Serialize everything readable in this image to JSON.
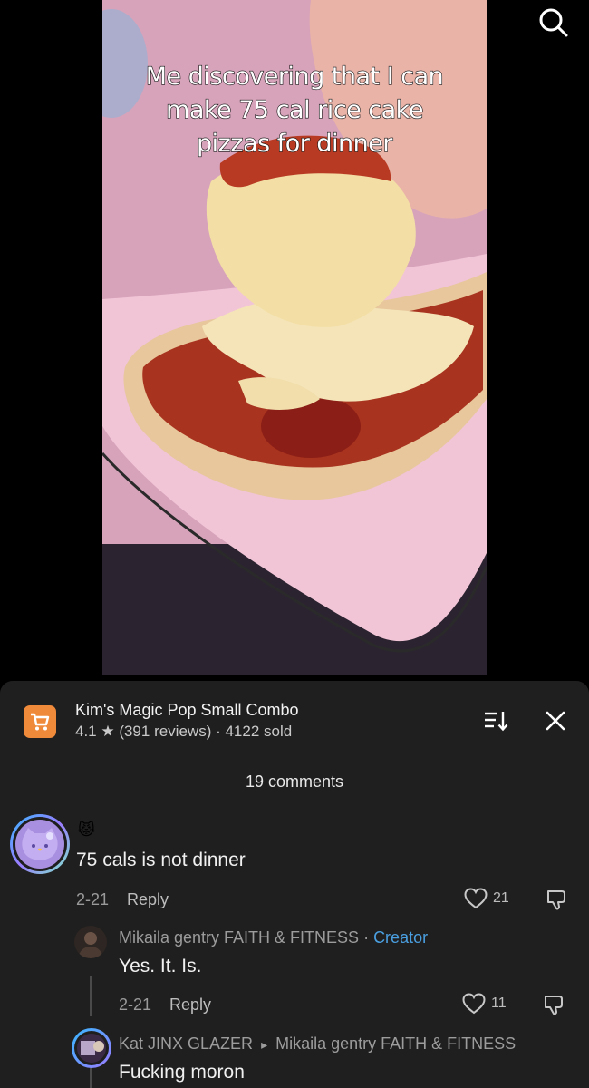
{
  "video": {
    "caption": "Me discovering that I can make 75 cal rice cake pizzas for dinner"
  },
  "product": {
    "title": "Kim's Magic Pop Small Combo",
    "meta": "4.1 ★ (391 reviews) · 4122 sold"
  },
  "comments_header": "19 comments",
  "comments": [
    {
      "emoji": "😾",
      "text": "75 cals is not dinner",
      "date": "2-21",
      "reply_label": "Reply",
      "likes": "21"
    }
  ],
  "replies": [
    {
      "author": "Mikaila gentry FAITH & FITNESS",
      "separator": " · ",
      "badge": "Creator",
      "text": "Yes. It. Is.",
      "date": "2-21",
      "reply_label": "Reply",
      "likes": "11"
    },
    {
      "author": "Kat JINX GLAZER",
      "arrow": "▸",
      "reply_to": "Mikaila gentry FAITH & FITNESS",
      "text": "Fucking moron"
    }
  ],
  "colors": {
    "sheet": "#1f1f1f",
    "accent_shop": "#f08a3b",
    "creator": "#4a9fe0"
  }
}
